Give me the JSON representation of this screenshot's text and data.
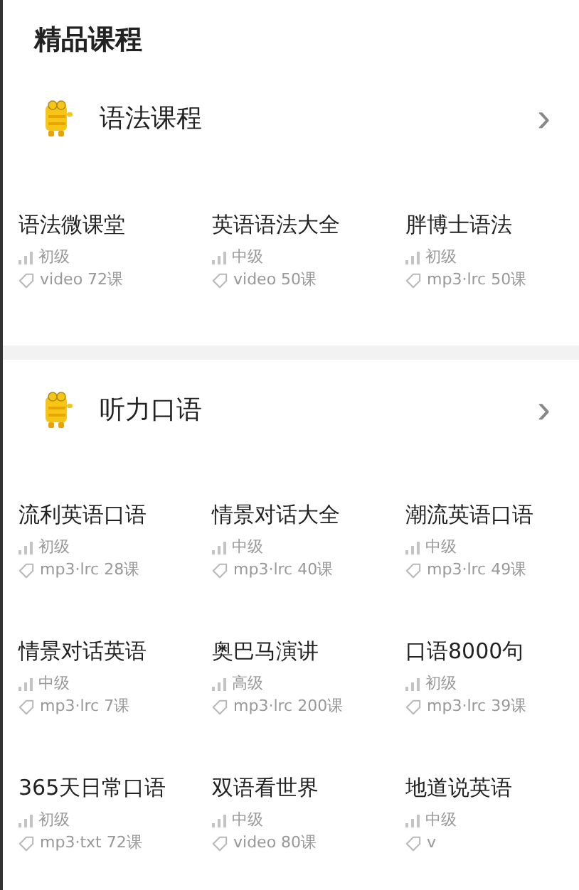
{
  "title": "精品课程",
  "sections": [
    {
      "name": "语法课程",
      "chevron": "›",
      "courses": [
        {
          "title": "语法微课堂",
          "level": "初级",
          "format": "video 72课"
        },
        {
          "title": "英语语法大全",
          "level": "中级",
          "format": "video 50课"
        },
        {
          "title": "胖博士语法",
          "level": "初级",
          "format": "mp3·lrc 50课"
        }
      ]
    },
    {
      "name": "听力口语",
      "chevron": "›",
      "courses": [
        {
          "title": "流利英语口语",
          "level": "初级",
          "format": "mp3·lrc 28课"
        },
        {
          "title": "情景对话大全",
          "level": "中级",
          "format": "mp3·lrc 40课"
        },
        {
          "title": "潮流英语口语",
          "level": "中级",
          "format": "mp3·lrc 49课"
        },
        {
          "title": "情景对话英语",
          "level": "中级",
          "format": "mp3·lrc 7课"
        },
        {
          "title": "奥巴马演讲",
          "level": "高级",
          "format": "mp3·lrc 200课"
        },
        {
          "title": "口语8000句",
          "level": "初级",
          "format": "mp3·lrc 39课"
        },
        {
          "title": "365天日常口语",
          "level": "初级",
          "format": "mp3·txt 72课"
        },
        {
          "title": "双语看世界",
          "level": "中级",
          "format": "video 80课"
        },
        {
          "title": "地道说英语",
          "level": "中级",
          "format": "v"
        }
      ]
    }
  ]
}
